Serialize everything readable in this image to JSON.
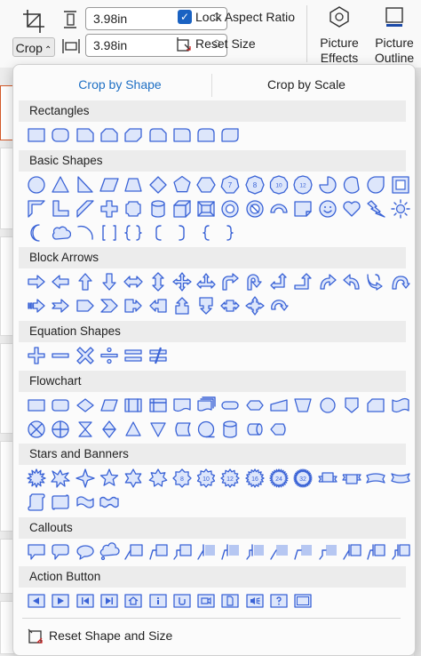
{
  "ribbon": {
    "crop_label": "Crop",
    "crop_caret": "⌃",
    "height_value": "3.98in",
    "width_value": "3.98in",
    "lock_label": "Lock Aspect Ratio",
    "lock_checked": true,
    "reset_size_label": "Reset Size",
    "picture_effects_label": "Picture Effects",
    "picture_outline_label": "Picture Outline"
  },
  "menu": {
    "tabs": [
      {
        "label": "Crop by Shape",
        "active": true
      },
      {
        "label": "Crop by Scale",
        "active": false
      }
    ],
    "sections": [
      {
        "title": "Rectangles",
        "rows": [
          [
            "rect",
            "round-rect",
            "snip1-rect",
            "snip2-same-rect",
            "snip2-diag-rect",
            "snip-round-rect",
            "round1-rect",
            "round2-same-rect",
            "round2-diag-rect"
          ]
        ]
      },
      {
        "title": "Basic Shapes",
        "rows": [
          [
            "oval",
            "triangle",
            "right-triangle",
            "parallelogram",
            "trapezoid",
            "diamond",
            "pentagon",
            "hexagon",
            "heptagon",
            "octagon",
            "decagon",
            "dodecagon",
            "pie",
            "chord",
            "teardrop",
            "frame"
          ],
          [
            "half-frame",
            "corner",
            "diagonal-stripe",
            "plus",
            "plaque",
            "can",
            "cube",
            "bevel",
            "donut",
            "no-symbol",
            "block-arc",
            "folded-corner",
            "smiley-face",
            "heart",
            "lightning-bolt",
            "sun"
          ],
          [
            "moon",
            "cloud",
            "arc",
            "double-bracket",
            "double-brace",
            "left-bracket",
            "right-bracket",
            "left-brace",
            "right-brace"
          ]
        ]
      },
      {
        "title": "Block Arrows",
        "rows": [
          [
            "right-arrow",
            "left-arrow",
            "up-arrow",
            "down-arrow",
            "left-right-arrow",
            "up-down-arrow",
            "quad-arrow",
            "left-right-up-arrow",
            "bent-arrow",
            "u-turn-arrow",
            "left-up-arrow",
            "bent-up-arrow",
            "curved-right-arrow",
            "curved-left-arrow",
            "curved-up-arrow",
            "curved-down-arrow"
          ],
          [
            "striped-right-arrow",
            "notched-right-arrow",
            "pentagon-arrow",
            "chevron",
            "right-arrow-callout",
            "left-arrow-callout",
            "up-arrow-callout",
            "down-arrow-callout",
            "left-right-arrow-callout",
            "quad-arrow-callout",
            "circular-arrow"
          ]
        ]
      },
      {
        "title": "Equation Shapes",
        "rows": [
          [
            "plus-sign",
            "minus-sign",
            "multiply-sign",
            "division-sign",
            "equal-sign",
            "not-equal-sign"
          ]
        ]
      },
      {
        "title": "Flowchart",
        "rows": [
          [
            "process",
            "alternate-process",
            "decision",
            "data",
            "predefined-process",
            "internal-storage",
            "document",
            "multidocument",
            "terminator",
            "preparation",
            "manual-input",
            "manual-operation",
            "connector",
            "off-page-connector",
            "card",
            "punched-tape"
          ],
          [
            "summing-junction",
            "or",
            "collate",
            "sort",
            "extract",
            "merge",
            "stored-data",
            "sequential-access",
            "magnetic-disk",
            "direct-access-storage",
            "display"
          ]
        ]
      },
      {
        "title": "Stars and Banners",
        "rows": [
          [
            "explosion1",
            "explosion2",
            "star4",
            "star5",
            "star6",
            "star7",
            "star8",
            "star10",
            "star12",
            "star16",
            "star24",
            "star32",
            "ribbon-up",
            "ribbon-down",
            "curved-ribbon-up",
            "curved-ribbon-down"
          ],
          [
            "vertical-scroll",
            "horizontal-scroll",
            "wave",
            "double-wave"
          ]
        ]
      },
      {
        "title": "Callouts",
        "rows": [
          [
            "rect-callout",
            "round-rect-callout",
            "oval-callout",
            "cloud-callout",
            "line-callout1",
            "line-callout2",
            "line-callout3",
            "line-callout1-accent",
            "line-callout2-accent",
            "line-callout3-accent",
            "line-callout1-border",
            "line-callout2-border",
            "line-callout3-border",
            "line-callout1-border-accent",
            "line-callout2-border-accent",
            "line-callout3-border-accent"
          ]
        ]
      },
      {
        "title": "Action Button",
        "rows": [
          [
            "action-back",
            "action-forward",
            "action-beginning",
            "action-end",
            "action-home",
            "action-information",
            "action-return",
            "action-movie",
            "action-document",
            "action-sound",
            "action-help",
            "action-blank"
          ]
        ]
      }
    ],
    "reset_label": "Reset Shape and Size"
  },
  "colors": {
    "accent": "#1d6fc4",
    "shape_stroke": "#3a63d6",
    "shape_fill": "#dde6fb",
    "header_bg": "#ececec"
  }
}
